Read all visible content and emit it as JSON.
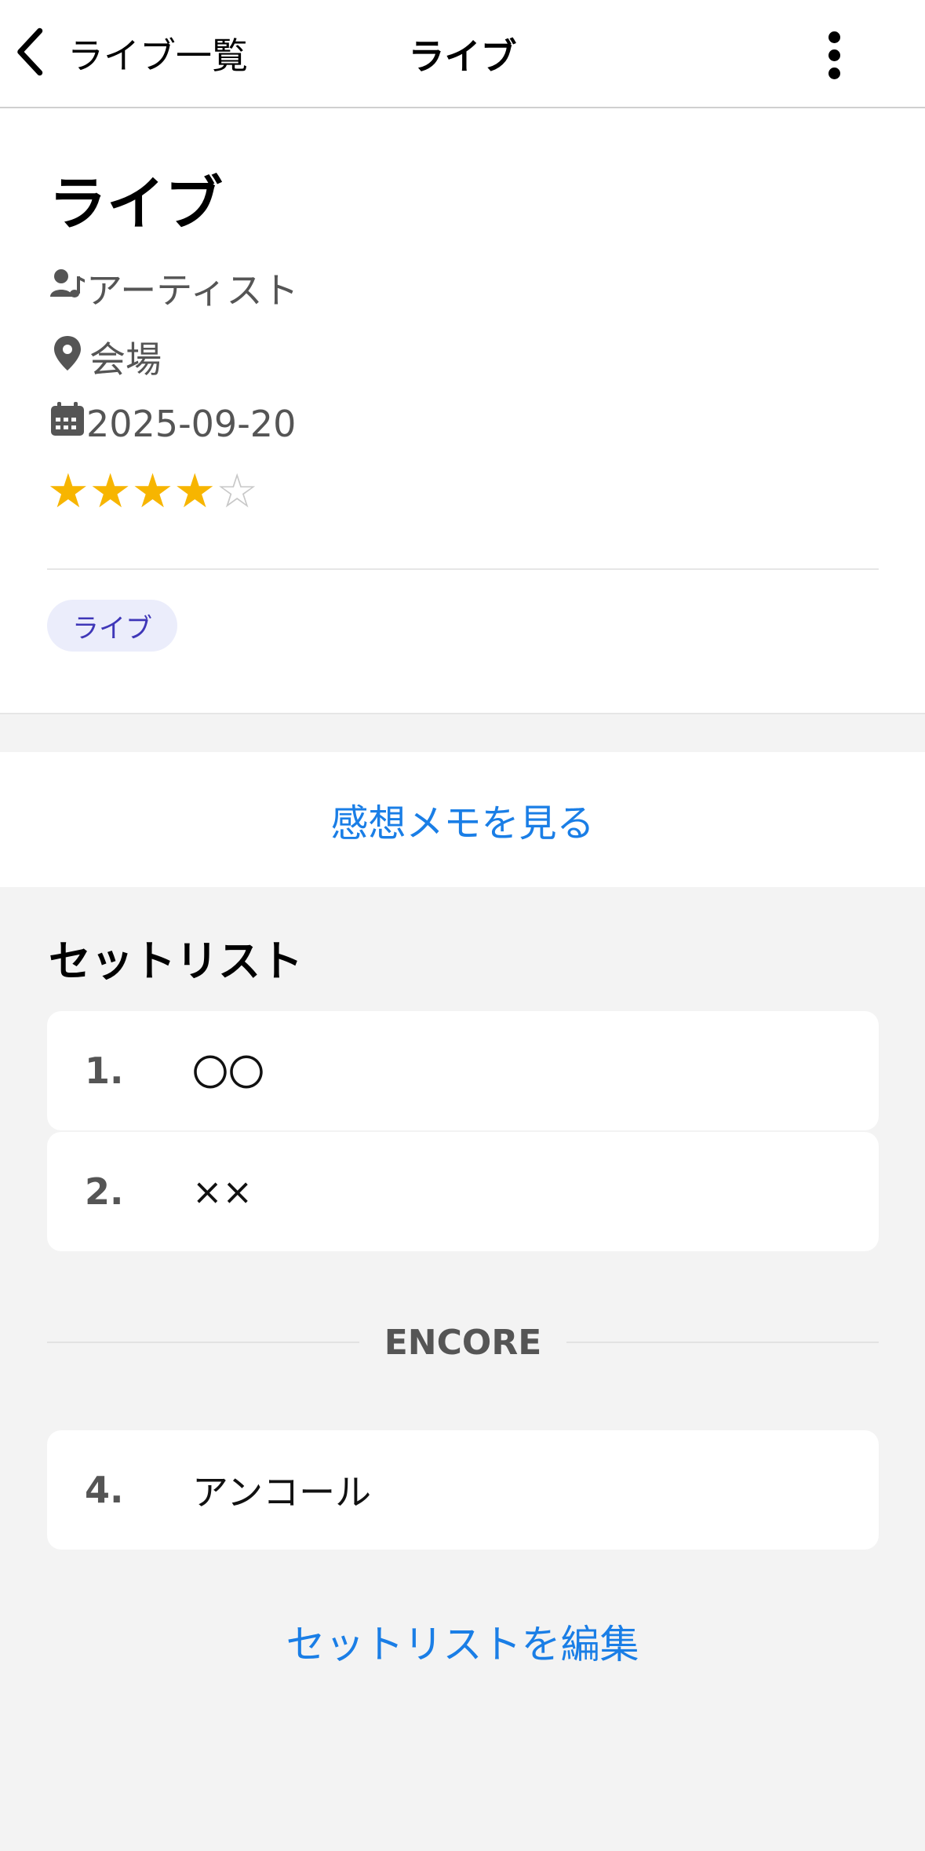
{
  "nav": {
    "back_label": "ライブ一覧",
    "title": "ライブ",
    "back_icon": "chevron-left-icon",
    "more_icon": "more-vertical-icon"
  },
  "detail": {
    "title": "ライブ",
    "artist": "アーティスト",
    "venue": "会場",
    "date": "2025-09-20",
    "rating": 4,
    "rating_max": 5,
    "tag": "ライブ",
    "star_color": "#f7b500"
  },
  "memo": {
    "label": "感想メモを見る"
  },
  "setlist": {
    "title": "セットリスト",
    "items": [
      {
        "num": "1.",
        "song": "〇〇"
      },
      {
        "num": "2.",
        "song": "××"
      }
    ],
    "encore_label": "ENCORE",
    "encore_items": [
      {
        "num": "4.",
        "song": "アンコール"
      }
    ],
    "edit_label": "セットリストを編集"
  },
  "colors": {
    "accent": "#1a7ee6",
    "tag_bg": "#ebedfb",
    "tag_text": "#3f37b8"
  }
}
